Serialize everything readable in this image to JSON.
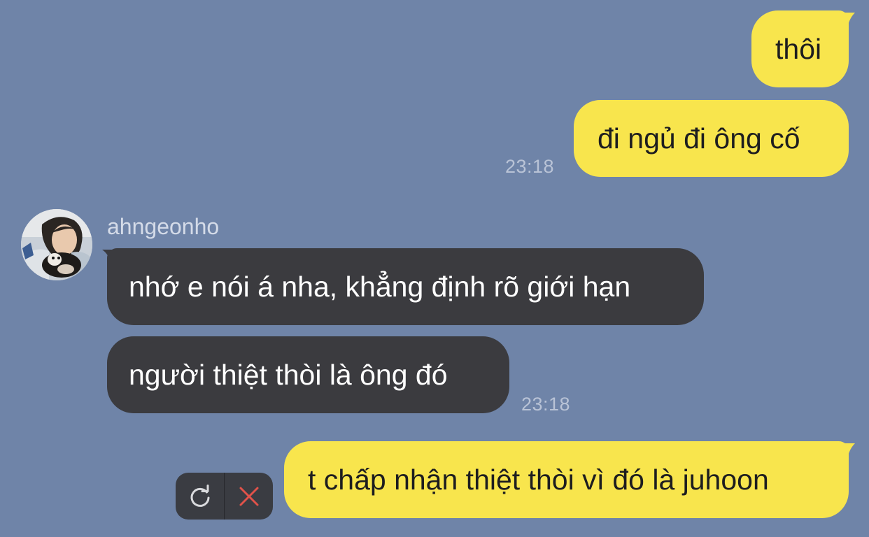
{
  "messages": {
    "out_1": "thôi",
    "out_2": "đi ngủ đi ông cố",
    "out_time_1": "23:18",
    "in_sender": "ahngeonho",
    "in_1": "nhớ e nói á nha, khẳng định rõ giới hạn",
    "in_2": "người thiệt thòi là ông đó",
    "in_time_1": "23:18",
    "out_pending": "t chấp nhận thiệt thòi vì đó là juhoon"
  },
  "failed_actions": {
    "retry_icon": "refresh-icon",
    "cancel_icon": "close-icon"
  },
  "colors": {
    "background": "#6f84a8",
    "outgoing_bubble": "#f8e54d",
    "incoming_bubble": "#3b3b3f",
    "cancel_red": "#e0524a"
  }
}
